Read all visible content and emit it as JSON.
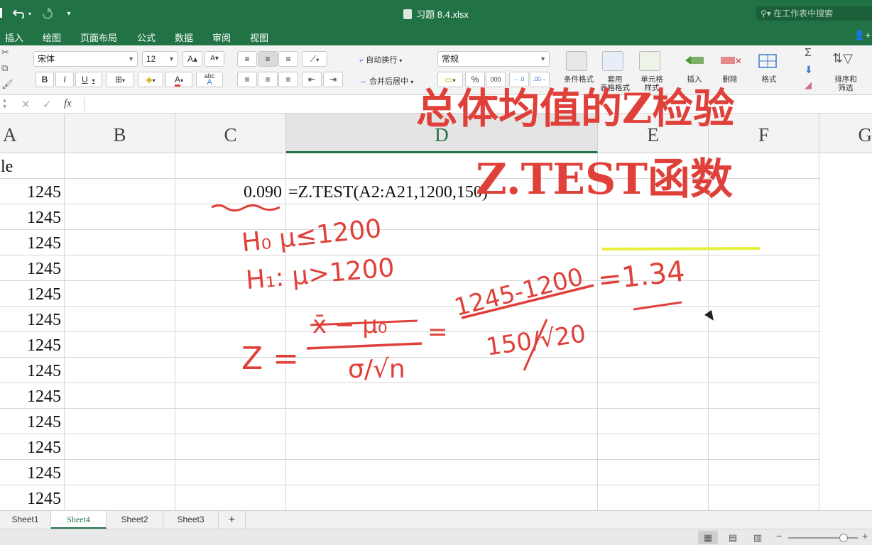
{
  "window": {
    "title": "习题 8.4.xlsx",
    "search_placeholder": "在工作表中搜索"
  },
  "menu": {
    "tabs": [
      "插入",
      "绘图",
      "页面布局",
      "公式",
      "数据",
      "审阅",
      "视图"
    ]
  },
  "ribbon": {
    "font_name": "宋体",
    "font_size": "12",
    "grow_font": "A",
    "shrink_font": "A",
    "bold": "B",
    "italic": "I",
    "underline": "U",
    "font_color_glyph": "A",
    "phonetic_top": "abc",
    "phonetic_bottom": "A",
    "wrap_text": "自动换行",
    "merge_center": "合并后居中",
    "number_format": "常规",
    "percent": "%",
    "comma": "000",
    "cond_format": "条件格式",
    "format_table": "套用\n表格格式",
    "cell_styles": "单元格\n样式",
    "insert": "插入",
    "delete": "删除",
    "format": "格式",
    "sort_filter": "排序和\n筛选"
  },
  "formula_bar": {
    "cancel": "✕",
    "enter": "✓",
    "fx": "fx"
  },
  "columns": [
    "A",
    "B",
    "C",
    "D",
    "E",
    "F",
    "G"
  ],
  "cells": {
    "a1": "le",
    "a_values": [
      "1245",
      "1245",
      "1245",
      "1245",
      "1245",
      "1245",
      "1245",
      "1245",
      "1245",
      "1245",
      "1245",
      "1245",
      "1245"
    ],
    "c2": "0.090",
    "d2": "=Z.TEST(A2:A21,1200,150)"
  },
  "sheets": {
    "tabs": [
      "Sheet1",
      "Sheet4",
      "Sheet2",
      "Sheet3"
    ],
    "active": "Sheet4",
    "add": "+"
  },
  "status": {
    "zoom_minus": "−",
    "zoom_plus": "+",
    "zoom_level": 0.8
  },
  "overlay": {
    "title_line1": "总体均值的Z检验",
    "title_line2": "Z.TEST函数",
    "ink_color": "#e0403a",
    "highlight_color": "#e6ef3c"
  },
  "annotations": {
    "h0": "H₀ μ≤1200",
    "h1": "H₁: μ>1200",
    "z_label": "Z =",
    "z_num": "x̄ − μ₀",
    "z_den": "σ/√n",
    "eq1": "=",
    "num_val": "1245-1200",
    "den_val": "150/√20",
    "result": "=1.34"
  }
}
